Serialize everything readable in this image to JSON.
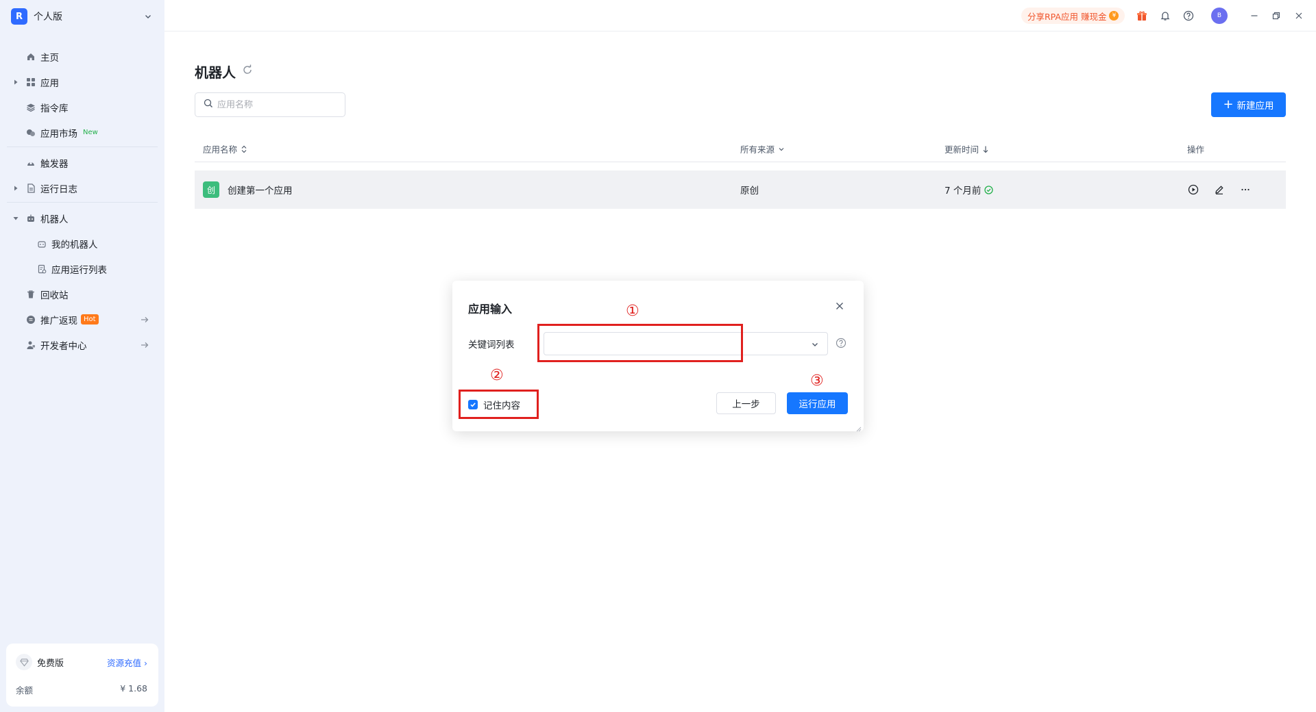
{
  "sidebar": {
    "brand": "个人版",
    "brand_logo_glyph": "R",
    "items": [
      {
        "label": "主页",
        "icon": "home-icon"
      },
      {
        "label": "应用",
        "icon": "apps-grid-icon"
      },
      {
        "label": "指令库",
        "icon": "layers-icon"
      },
      {
        "label": "应用市场",
        "icon": "market-icon",
        "badge": "New"
      },
      {
        "label": "触发器",
        "icon": "trigger-icon"
      },
      {
        "label": "运行日志",
        "icon": "document-icon"
      },
      {
        "label": "机器人",
        "icon": "robot-icon"
      },
      {
        "label": "我的机器人",
        "icon": "robot-icon"
      },
      {
        "label": "应用运行列表",
        "icon": "run-list-icon"
      },
      {
        "label": "回收站",
        "icon": "trash-icon"
      },
      {
        "label": "推广返现",
        "icon": "coin-icon",
        "badge": "Hot"
      },
      {
        "label": "开发者中心",
        "icon": "developer-icon"
      }
    ],
    "plan": {
      "name": "免费版",
      "link": "资源充值",
      "link_arrow": "›",
      "balance_label": "余额",
      "balance": "¥ 1.68"
    }
  },
  "topbar": {
    "promo": "分享RPA应用 赚现金",
    "promo_coin": "¥",
    "avatar": "B"
  },
  "main": {
    "title": "机器人",
    "search_placeholder": "应用名称",
    "new_button": "新建应用",
    "new_button_plus": "+",
    "columns": {
      "name": "应用名称",
      "source": "所有来源",
      "updated": "更新时间",
      "actions": "操作"
    },
    "rows": [
      {
        "icon_glyph": "创",
        "name": "创建第一个应用",
        "source": "原创",
        "updated": "7 个月前"
      }
    ]
  },
  "dialog": {
    "title": "应用输入",
    "field_label": "关键词列表",
    "field_value": "",
    "remember_label": "记住内容",
    "remember_checked": true,
    "prev_button": "上一步",
    "run_button": "运行应用"
  },
  "annotations": [
    "①",
    "②",
    "③"
  ],
  "colors": {
    "accent": "#1677ff",
    "sidebar_bg": "#eef2fb",
    "annotation_red": "#e0201e",
    "promo_text": "#f0552c",
    "new_badge": "#22b04a",
    "hot_badge": "#ff7a1a"
  }
}
